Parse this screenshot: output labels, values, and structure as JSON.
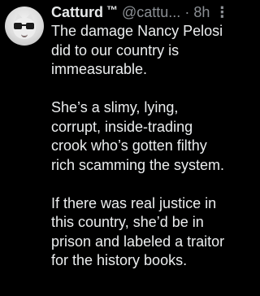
{
  "tweet": {
    "author_name": "Catturd",
    "trademark": "™",
    "handle": "@cattu...",
    "separator": "·",
    "timestamp": "8h",
    "more_icon": "more-dots-vertical",
    "paragraphs": [
      "The damage Nancy Pelosi\ndid to our country is\nimmeasurable.",
      "She’s a slimy, lying,\ncorrupt, inside-trading\ncrook who’s gotten filthy\nrich scamming the system.",
      "If there was real justice in\nthis country, she’d be in\nprison and labeled a traitor\nfor the history books."
    ]
  },
  "colors": {
    "background": "#000000",
    "primary_text": "#e7e9ea",
    "secondary_text": "#8b8f94"
  }
}
